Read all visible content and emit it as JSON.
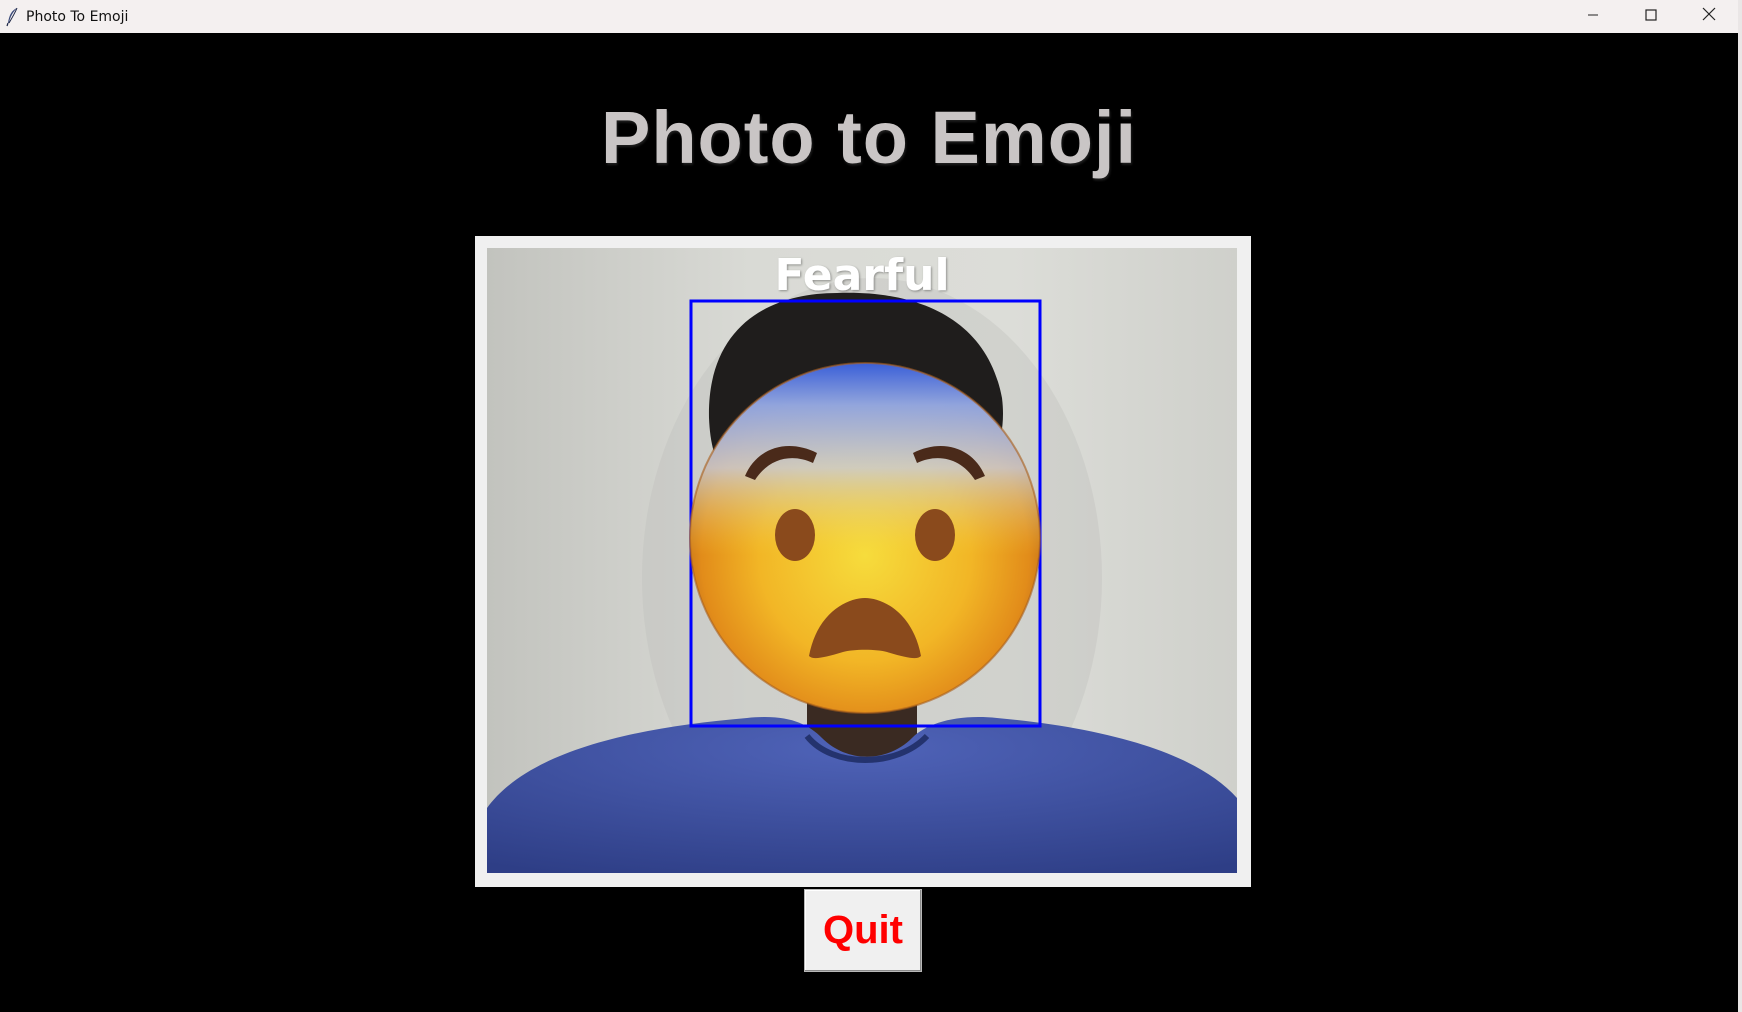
{
  "window": {
    "title": "Photo To Emoji",
    "controls": {
      "minimize": "minimize-icon",
      "maximize": "maximize-icon",
      "close": "close-icon"
    }
  },
  "main": {
    "heading": "Photo to Emoji",
    "video": {
      "emotion_label": "Fearful",
      "face_box_color": "#0000ff",
      "emoji": "fearful-face-emoji"
    },
    "quit_label": "Quit"
  },
  "colors": {
    "background": "#000000",
    "heading": "#c9c5c5",
    "quit_text": "#ff0000",
    "panel_border": "#f0f0f0"
  }
}
